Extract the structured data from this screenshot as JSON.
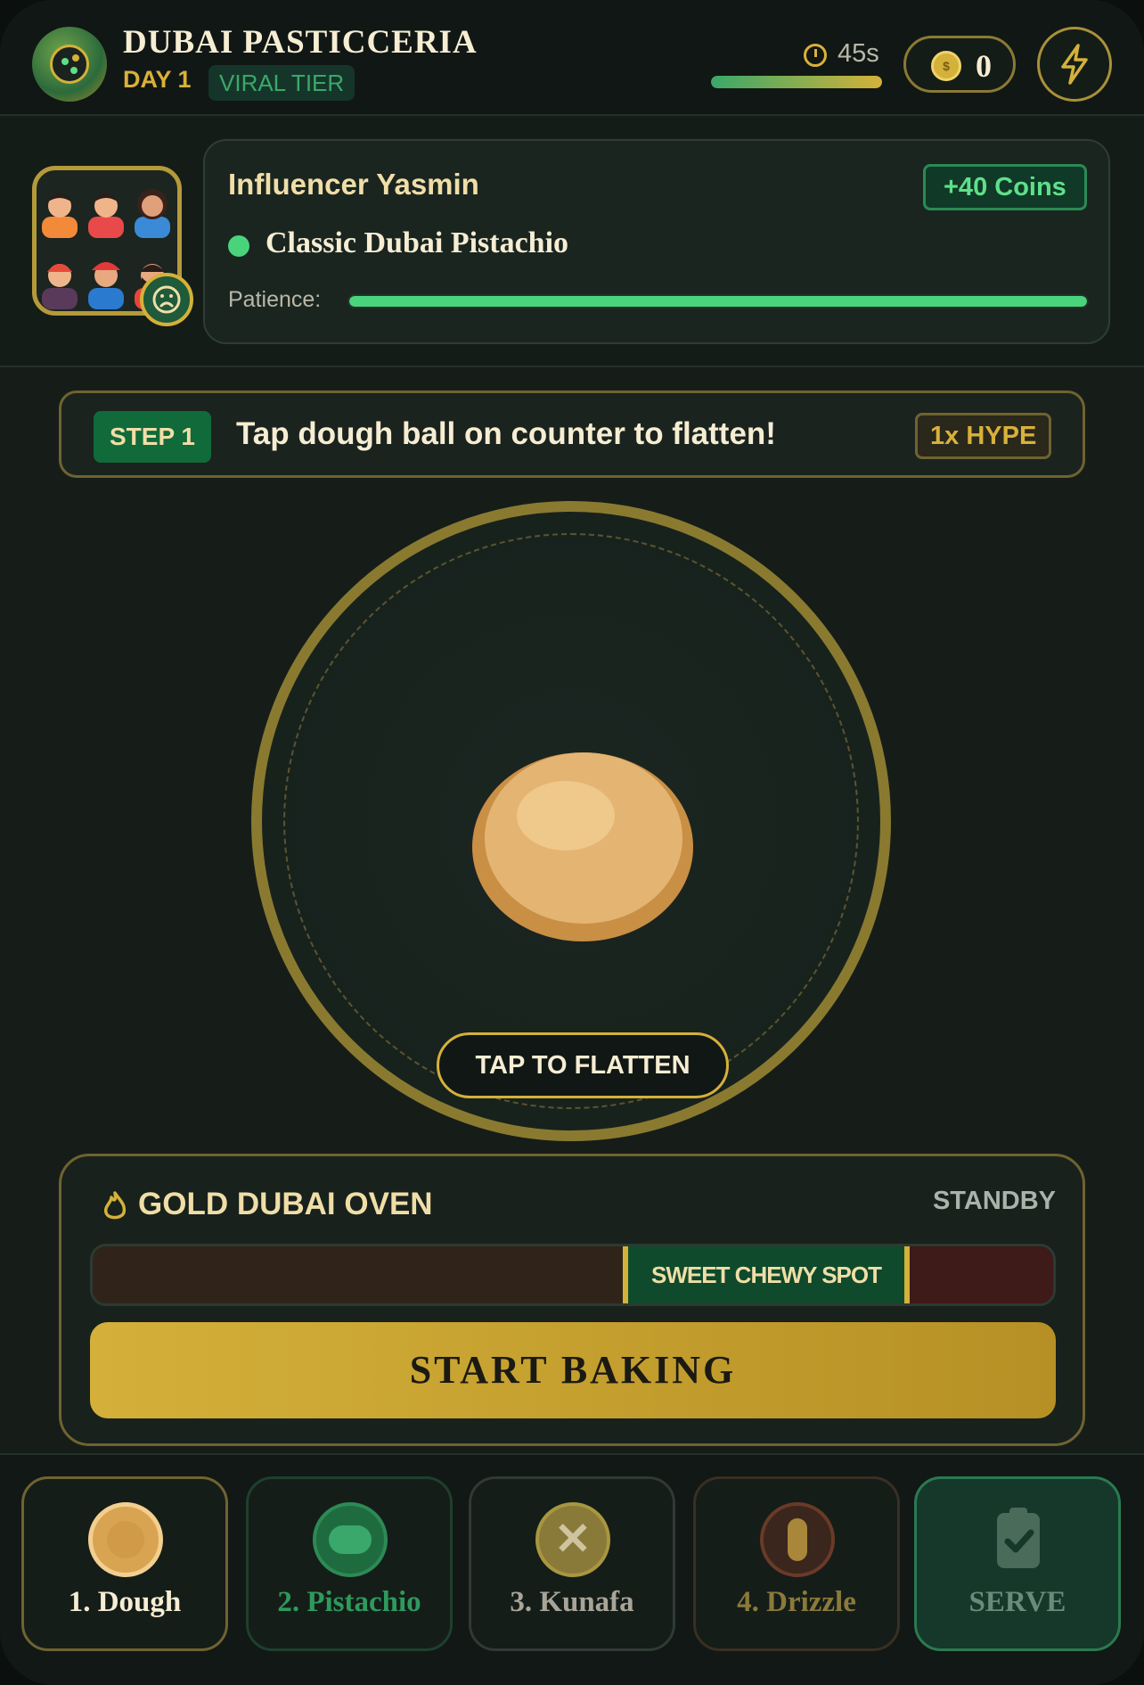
{
  "header": {
    "title": "DUBAI PASTICCERIA",
    "day": "DAY 1",
    "tier": "VIRAL TIER",
    "timer": "45s",
    "timer_fraction": 1.0,
    "coins": "0"
  },
  "customer": {
    "name": "Influencer Yasmin",
    "reward": "+40 Coins",
    "order": "Classic Dubai Pistachio",
    "patience_label": "Patience:",
    "patience_fraction": 1.0
  },
  "step": {
    "tag": "STEP 1",
    "instruction": "Tap dough ball on counter to flatten!",
    "hype": "1x HYPE"
  },
  "counter": {
    "tap_label": "TAP TO FLATTEN"
  },
  "oven": {
    "title": "GOLD DUBAI OVEN",
    "status": "STANDBY",
    "sweet_spot_label": "SWEET CHEWY SPOT",
    "bake_label": "START BAKING"
  },
  "tools": [
    {
      "label": "1. Dough",
      "icon": "dough-icon"
    },
    {
      "label": "2. Pistachio",
      "icon": "pistachio-icon"
    },
    {
      "label": "3. Kunafa",
      "icon": "kunafa-icon"
    },
    {
      "label": "4. Drizzle",
      "icon": "drizzle-icon"
    },
    {
      "label": "SERVE",
      "icon": "clipboard-check-icon"
    }
  ],
  "colors": {
    "gold": "#d4b13a",
    "green": "#49d47c",
    "background": "#161d19"
  }
}
